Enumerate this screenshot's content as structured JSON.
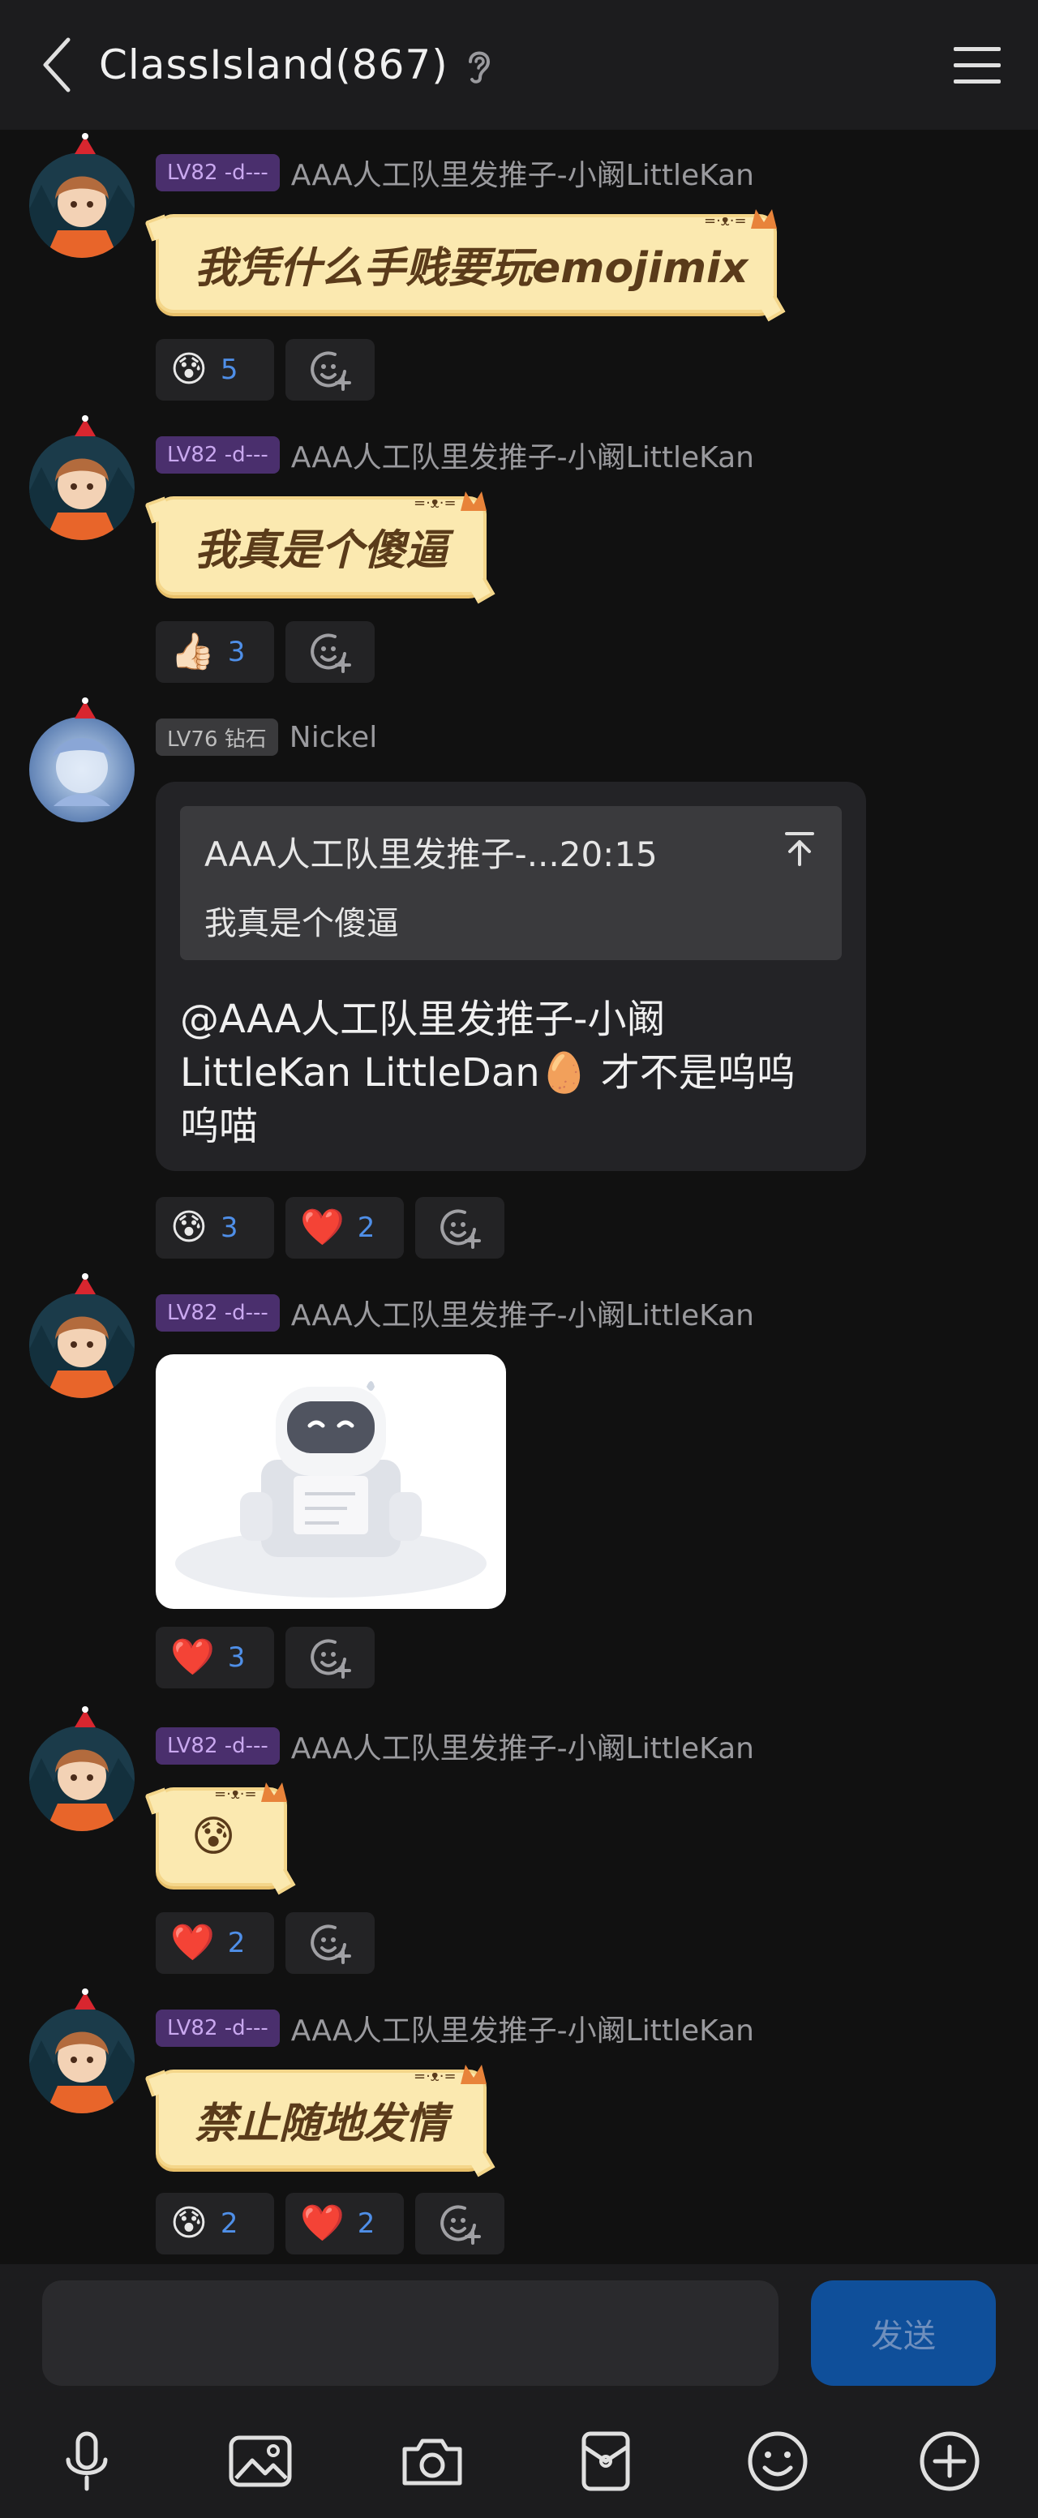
{
  "header": {
    "title": "ClassIsland(867)"
  },
  "messages": [
    {
      "level": "LV82 -d---",
      "nick": "AAA人工队里发推子-小阚LittleKan",
      "text": "我凭什么手贱要玩emojimix",
      "reactions": [
        {
          "emoji": "😰",
          "count": "5"
        }
      ]
    },
    {
      "level": "LV82 -d---",
      "nick": "AAA人工队里发推子-小阚LittleKan",
      "text": "我真是个傻逼",
      "reactions": [
        {
          "emoji": "👍🏻",
          "count": "3"
        }
      ]
    },
    {
      "level": "LV76 钻石",
      "nick": "Nickel",
      "quote_head": "AAA人工队里发推子-...20:15",
      "quote_body": "我真是个傻逼",
      "text": "@AAA人工队里发推子-小阚LittleKan LittleDan🥚 才不是呜呜呜喵",
      "reactions": [
        {
          "emoji": "😰",
          "count": "3"
        },
        {
          "emoji": "❤️",
          "count": "2"
        }
      ]
    },
    {
      "level": "LV82 -d---",
      "nick": "AAA人工队里发推子-小阚LittleKan",
      "reactions": [
        {
          "emoji": "❤️",
          "count": "3"
        }
      ]
    },
    {
      "level": "LV82 -d---",
      "nick": "AAA人工队里发推子-小阚LittleKan",
      "text": "😰",
      "reactions": [
        {
          "emoji": "❤️",
          "count": "2"
        }
      ]
    },
    {
      "level": "LV82 -d---",
      "nick": "AAA人工队里发推子-小阚LittleKan",
      "text": "禁止随地发情",
      "reactions": [
        {
          "emoji": "😰",
          "count": "2"
        },
        {
          "emoji": "❤️",
          "count": "2"
        }
      ]
    }
  ],
  "composer": {
    "send_label": "发送"
  },
  "icons": {
    "back": "chevron-left-icon",
    "ear": "ear-icon",
    "menu": "hamburger-icon",
    "add_reaction": "add-reaction-icon",
    "mic": "microphone-icon",
    "image": "image-icon",
    "camera": "camera-icon",
    "red_packet": "red-packet-icon",
    "emoji": "emoji-icon",
    "plus": "plus-circle-icon"
  },
  "colors": {
    "accent": "#4f8fe8",
    "send": "#0f4f9a",
    "bubble": "#fbe9b0",
    "level_purple": "#4a2f6d"
  }
}
